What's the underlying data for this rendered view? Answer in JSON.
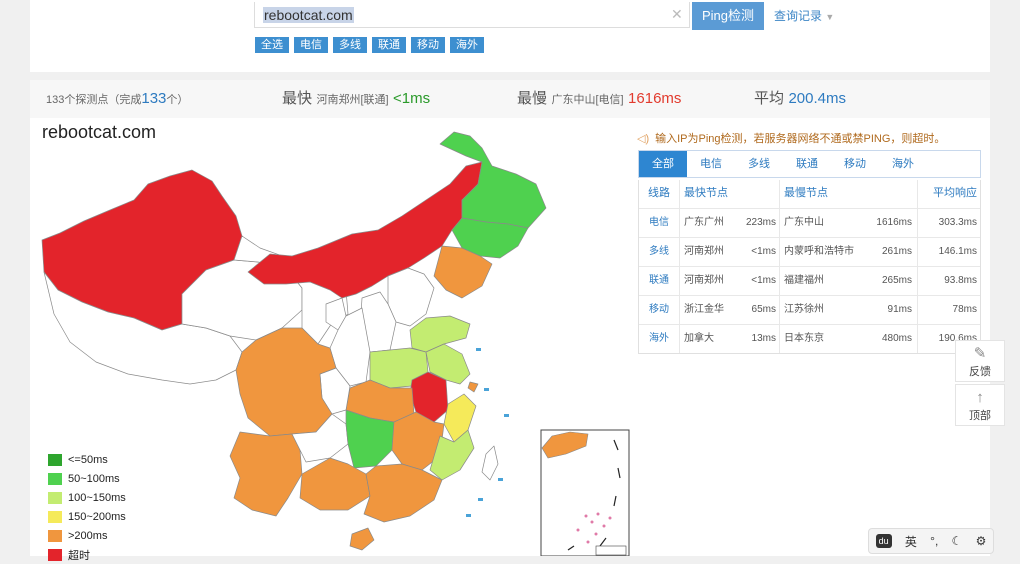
{
  "search": {
    "value": "rebootcat.com",
    "button_label": "Ping检测",
    "history_label": "查询记录"
  },
  "filters": [
    "全选",
    "电信",
    "多线",
    "联通",
    "移动",
    "海外"
  ],
  "summary": {
    "points_prefix": "133个探测点（完成",
    "points_done": "133",
    "points_suffix": "个）",
    "fast_label": "最快",
    "fast_location": "河南郑州[联通]",
    "fast_value": "<1ms",
    "slow_label": "最慢",
    "slow_location": "广东中山[电信]",
    "slow_value": "1616ms",
    "avg_label": "平均",
    "avg_value": "200.4ms"
  },
  "map": {
    "title": "rebootcat.com",
    "legend": [
      {
        "label": "<=50ms",
        "color": "#2ea52e"
      },
      {
        "label": "50~100ms",
        "color": "#4fd14f"
      },
      {
        "label": "100~150ms",
        "color": "#c3ec71"
      },
      {
        "label": "150~200ms",
        "color": "#f5ea5a"
      },
      {
        "label": ">200ms",
        "color": "#f0963e"
      },
      {
        "label": "超时",
        "color": "#e3242b"
      }
    ]
  },
  "chart_data": {
    "type": "map",
    "title": "rebootcat.com",
    "categories": [
      "<=50ms",
      "50~100ms",
      "100~150ms",
      "150~200ms",
      ">200ms",
      "超时"
    ],
    "colors": [
      "#2ea52e",
      "#4fd14f",
      "#c3ec71",
      "#f5ea5a",
      "#f0963e",
      "#e3242b"
    ]
  },
  "notice": "输入IP为Ping检测，若服务器网络不通或禁PING，则超时。",
  "tabs": [
    "全部",
    "电信",
    "多线",
    "联通",
    "移动",
    "海外"
  ],
  "table": {
    "headers": {
      "line": "线路",
      "fastest": "最快节点",
      "slowest": "最慢节点",
      "avg": "平均响应"
    },
    "rows": [
      {
        "line": "电信",
        "fast_node": "广东广州",
        "fast_ms": "223ms",
        "slow_node": "广东中山",
        "slow_ms": "1616ms",
        "avg": "303.3ms"
      },
      {
        "line": "多线",
        "fast_node": "河南郑州",
        "fast_ms": "<1ms",
        "slow_node": "内蒙呼和浩特市",
        "slow_ms": "261ms",
        "avg": "146.1ms"
      },
      {
        "line": "联通",
        "fast_node": "河南郑州",
        "fast_ms": "<1ms",
        "slow_node": "福建福州",
        "slow_ms": "265ms",
        "avg": "93.8ms"
      },
      {
        "line": "移动",
        "fast_node": "浙江金华",
        "fast_ms": "65ms",
        "slow_node": "江苏徐州",
        "slow_ms": "91ms",
        "avg": "78ms"
      },
      {
        "line": "海外",
        "fast_node": "加拿大",
        "fast_ms": "13ms",
        "slow_node": "日本东京",
        "slow_ms": "480ms",
        "avg": "190.6ms"
      }
    ]
  },
  "side": {
    "feedback": "反馈",
    "top": "顶部"
  },
  "ime": {
    "badge": "du",
    "lang": "英"
  }
}
